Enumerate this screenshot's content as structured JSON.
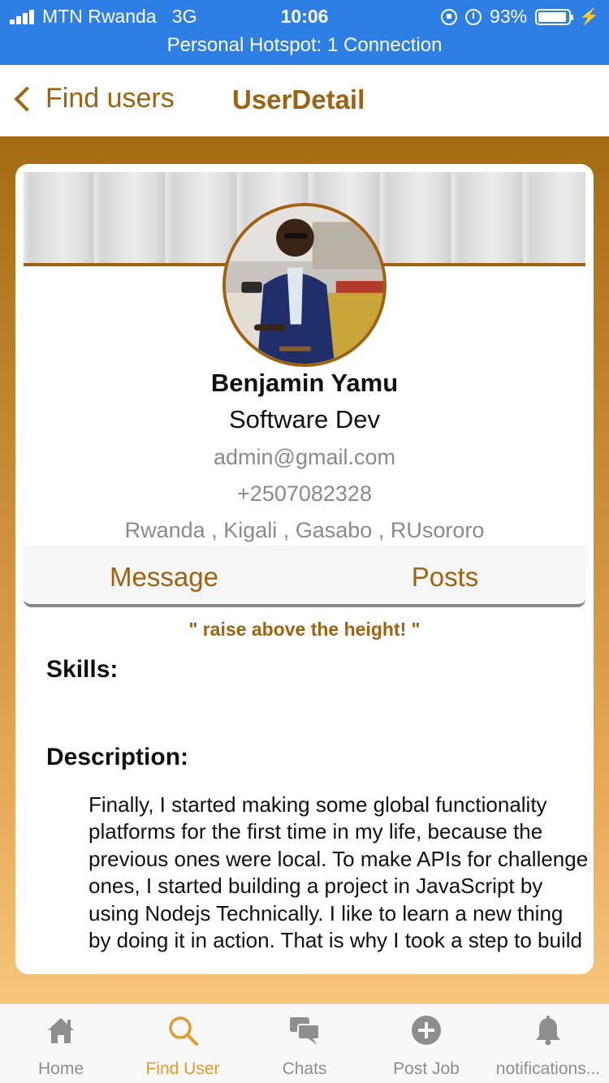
{
  "status_bar": {
    "carrier": "MTN Rwanda",
    "network": "3G",
    "time": "10:06",
    "battery_percent_label": "93%",
    "battery_level": 0.93,
    "hotspot": "Personal Hotspot: 1 Connection",
    "color": "#2d7fe6"
  },
  "nav": {
    "back_label": "Find users",
    "title": "UserDetail",
    "accent": "#a0620f"
  },
  "profile": {
    "name": "Benjamin Yamu",
    "role": "Software Dev",
    "email": "admin@gmail.com",
    "phone": "+2507082328",
    "address": "Rwanda , Kigali , Gasabo , RUsororo",
    "message_label": "Message",
    "posts_label": "Posts",
    "quote": "\" raise above the height! \"",
    "skills_heading": "Skills:",
    "skills_value": "",
    "description_heading": "Description:",
    "description": " Finally, I started making some global functionality platforms for the first time in my life, because the previous ones were local. To make APIs for challenge ones, I started building a project in JavaScript by using Nodejs Technically. I like to learn a new thing by doing it in action. That is why I took a step to build"
  },
  "tabs": [
    {
      "label": "Home",
      "icon": "home-icon",
      "active": false
    },
    {
      "label": "Find User",
      "icon": "search-icon",
      "active": true
    },
    {
      "label": "Chats",
      "icon": "chats-icon",
      "active": false
    },
    {
      "label": "Post Job",
      "icon": "add-circle-icon",
      "active": false
    },
    {
      "label": "notifications...",
      "icon": "bell-icon",
      "active": false
    }
  ],
  "colors": {
    "tab_active": "#e49a2b",
    "tab_inactive": "#8e8e8e",
    "gradient_top": "#a56b12",
    "gradient_bottom": "#f6c57a"
  }
}
